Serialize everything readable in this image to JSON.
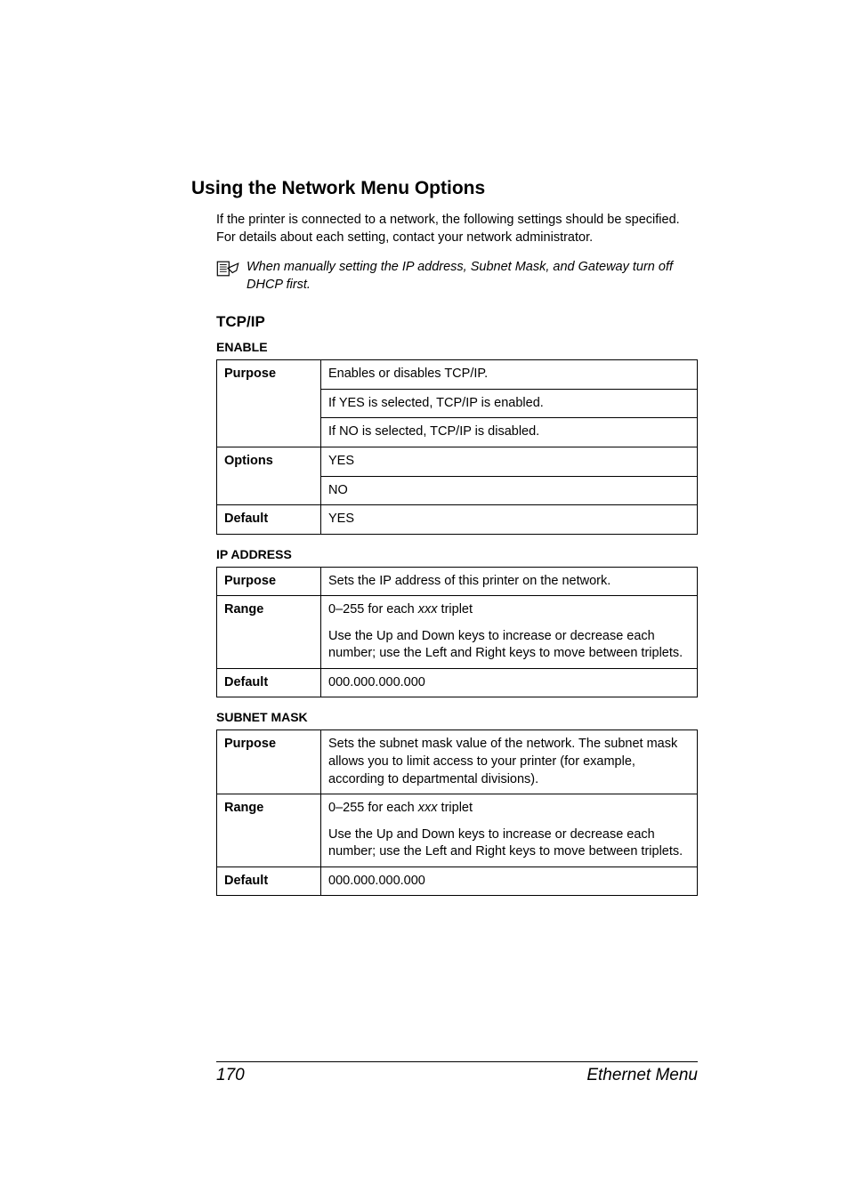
{
  "heading": "Using the Network Menu Options",
  "intro": "If the printer is connected to a network, the following settings should be specified. For details about each setting, contact your network administrator.",
  "note": "When manually setting the IP address, Subnet Mask, and Gateway turn off DHCP first.",
  "tcpip_heading": "TCP/IP",
  "enable": {
    "title": "ENABLE",
    "purpose_label": "Purpose",
    "purpose_l1": "Enables or disables TCP/IP.",
    "purpose_l2": "If YES is selected, TCP/IP is enabled.",
    "purpose_l3": "If NO is selected, TCP/IP is disabled.",
    "options_label": "Options",
    "options_l1": "YES",
    "options_l2": "NO",
    "default_label": "Default",
    "default_val": "YES"
  },
  "ip": {
    "title": "IP ADDRESS",
    "purpose_label": "Purpose",
    "purpose_text": "Sets the IP address of this printer on the network.",
    "range_label": "Range",
    "range_prefix": "0–255 for each ",
    "range_var": "xxx",
    "range_suffix": " triplet",
    "range_l2": "Use the Up and Down keys to increase or decrease each number; use the Left and Right keys to move between triplets.",
    "default_label": "Default",
    "default_val": "000.000.000.000"
  },
  "subnet": {
    "title": "SUBNET MASK",
    "purpose_label": "Purpose",
    "purpose_text": "Sets the subnet mask value of the network. The subnet mask allows you to limit access to your printer (for example, according to departmental divisions).",
    "range_label": "Range",
    "range_prefix": "0–255 for each ",
    "range_var": "xxx",
    "range_suffix": " triplet",
    "range_l2": "Use the Up and Down keys to increase or decrease each number; use the Left and Right keys to move between triplets.",
    "default_label": "Default",
    "default_val": "000.000.000.000"
  },
  "footer": {
    "page": "170",
    "label": "Ethernet Menu"
  }
}
